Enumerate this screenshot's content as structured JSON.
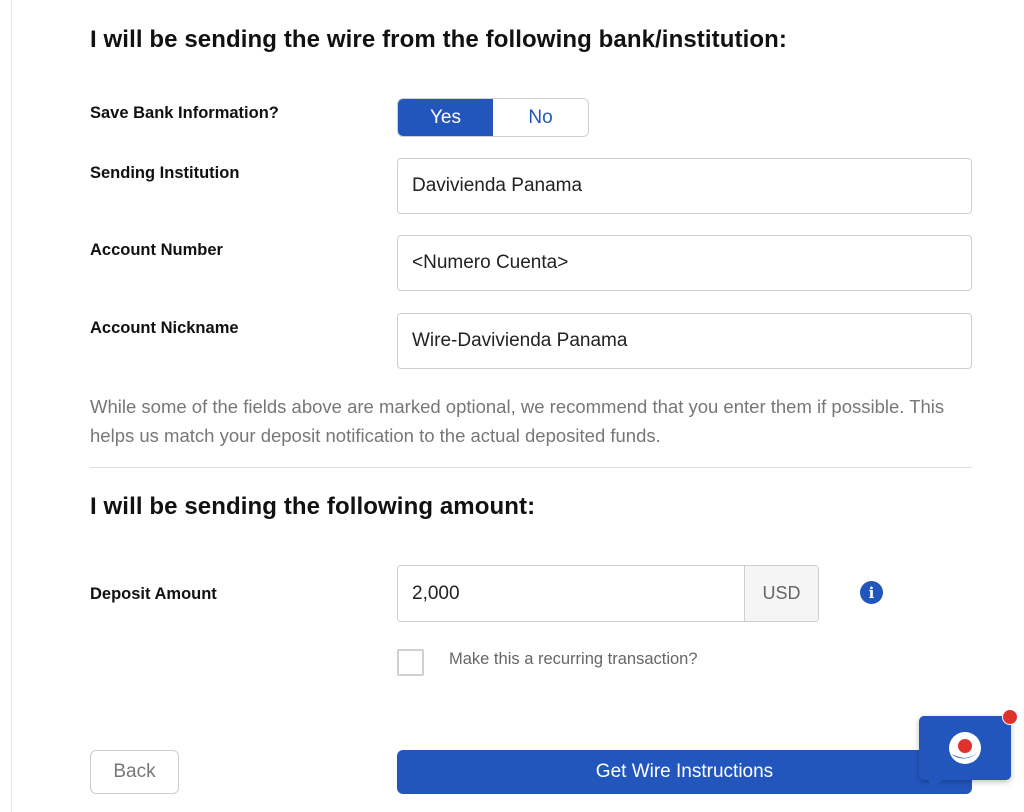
{
  "bank_section": {
    "title": "I will be sending the wire from the following bank/institution:",
    "save_bank": {
      "label": "Save Bank Information?",
      "yes_label": "Yes",
      "no_label": "No",
      "selected": "Yes"
    },
    "sending_institution": {
      "label": "Sending Institution",
      "value": "Davivienda Panama"
    },
    "account_number": {
      "label": "Account Number",
      "value": "<Numero Cuenta>"
    },
    "account_nickname": {
      "label": "Account Nickname",
      "value": "Wire-Davivienda Panama"
    },
    "help_text": "While some of the fields above are marked optional, we recommend that you enter them if possible. This helps us match your deposit notification to the actual deposited funds."
  },
  "amount_section": {
    "title": "I will be sending the following amount:",
    "deposit_amount": {
      "label": "Deposit Amount",
      "value": "2,000",
      "currency": "USD"
    },
    "info_icon": "info-circle-icon",
    "recurring": {
      "label": "Make this a recurring transaction?",
      "checked": false
    }
  },
  "actions": {
    "back_label": "Back",
    "primary_label": "Get Wire Instructions"
  },
  "chat_widget": {
    "icon": "chat-support-icon",
    "has_notification": true
  },
  "colors": {
    "primary": "#2356bd",
    "notification": "#e0322c",
    "help_text": "#777777",
    "border": "#cfcfcf"
  }
}
